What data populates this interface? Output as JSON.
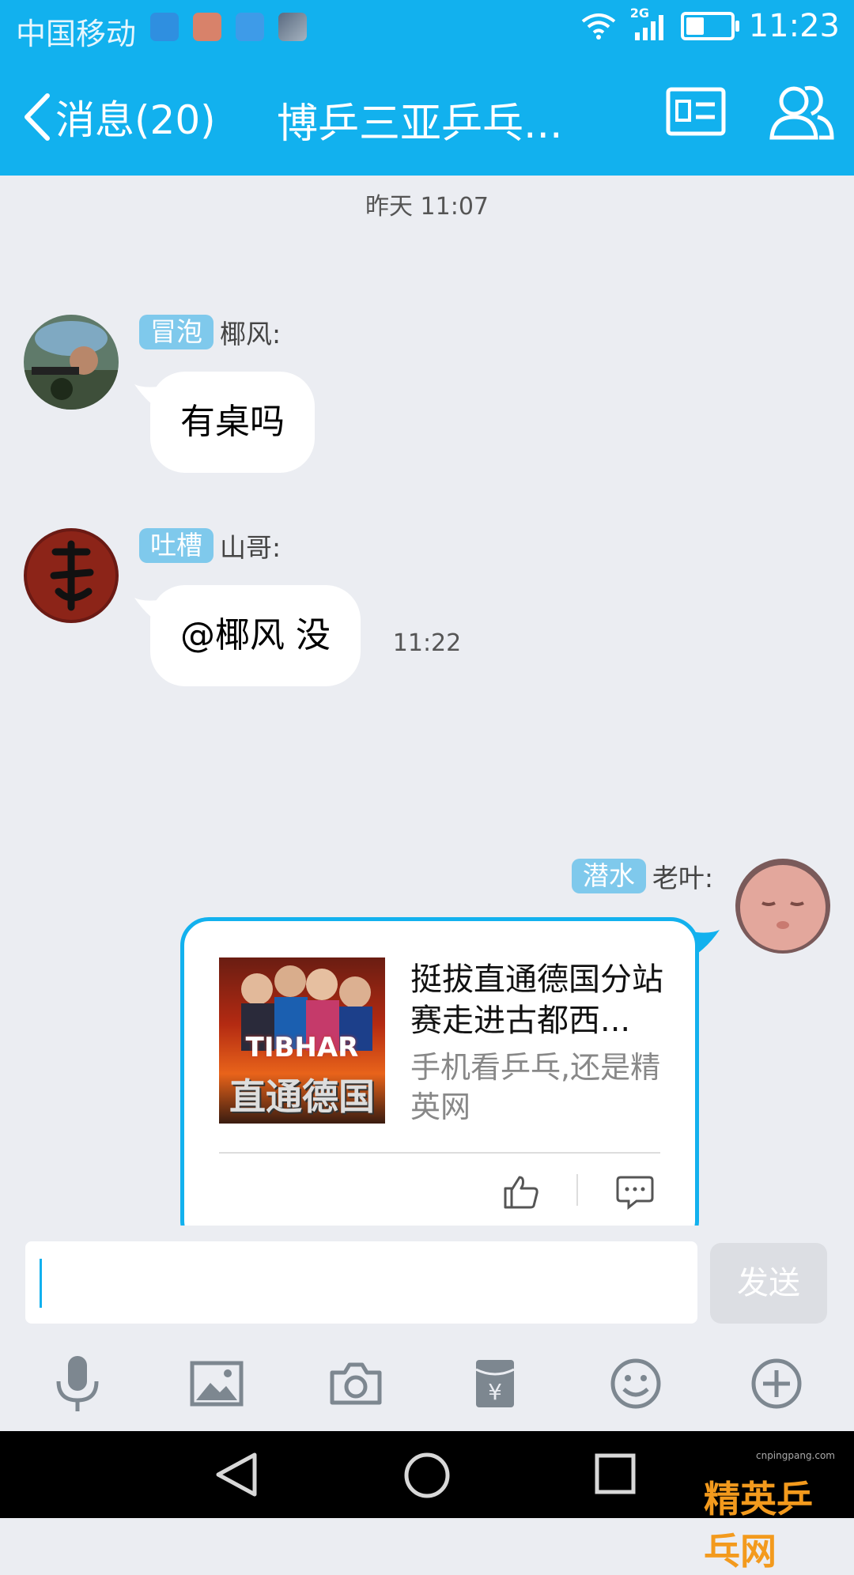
{
  "status_bar": {
    "carrier": "中国移动",
    "network": "2G",
    "time": "11:23",
    "battery_level": 0.4
  },
  "header": {
    "back_label": "消息(20)",
    "title": "博乒三亚乒乓...",
    "profile_icon": "id-card-icon",
    "members_icon": "people-icon"
  },
  "messages": {
    "ts1": "昨天 11:07",
    "m1": {
      "badge": "冒泡",
      "name": "椰风:",
      "text": "有桌吗"
    },
    "m2": {
      "badge": "吐槽",
      "name": "山哥:",
      "text": "@椰风 没"
    },
    "ts2": "11:22",
    "m3": {
      "badge": "潜水",
      "name": "老叶:",
      "card_title": "挺拔直通德国分站赛走进古都西...",
      "card_desc": "手机看乒乓,还是精英网",
      "thumb_brand": "TIBHAR",
      "thumb_caption": "直通德国"
    }
  },
  "input": {
    "value": "",
    "send_label": "发送"
  },
  "toolbar": {
    "icons": [
      "microphone-icon",
      "image-icon",
      "camera-icon",
      "red-packet-icon",
      "emoji-icon",
      "plus-icon"
    ]
  },
  "watermark": {
    "text": "精英乒乓网",
    "site": "cnpingpang.com"
  },
  "colors": {
    "accent": "#12b1ee",
    "background": "#ebedf2",
    "badge": "#7fc9ec"
  }
}
